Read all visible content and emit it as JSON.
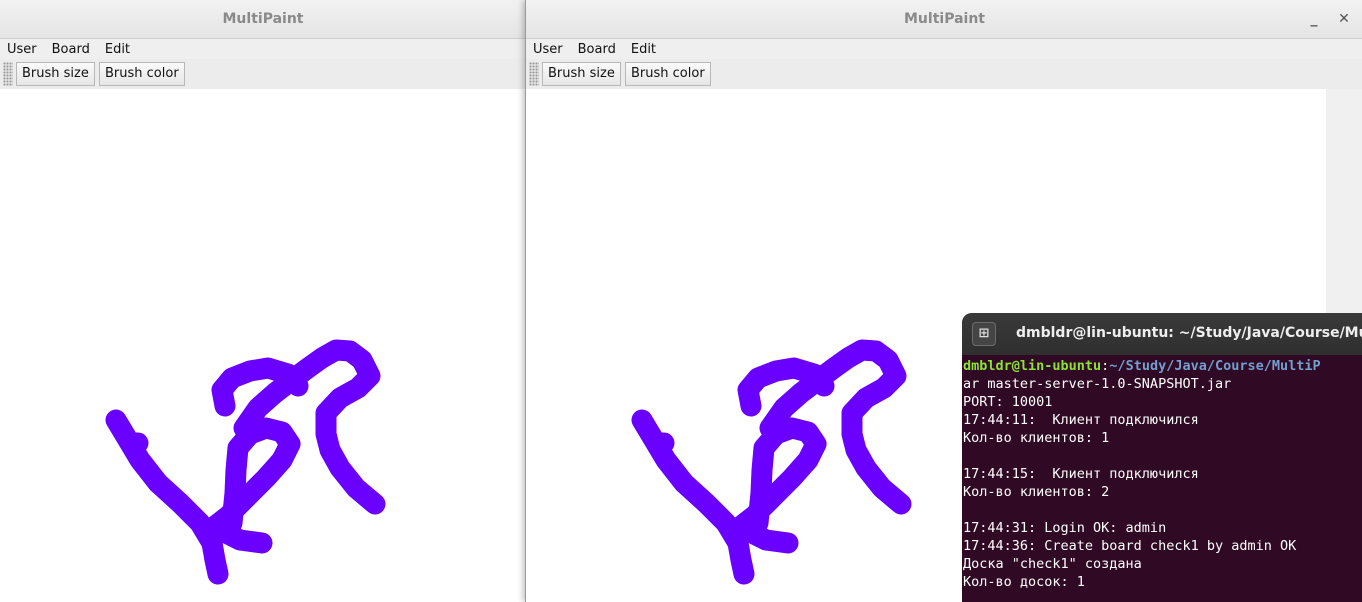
{
  "app": {
    "title": "MultiPaint",
    "menu": [
      "User",
      "Board",
      "Edit"
    ],
    "toolbar": {
      "brush_size": "Brush size",
      "brush_color": "Brush color"
    },
    "stroke_color": "#6a00ff",
    "window_controls": {
      "minimize": "_",
      "close": "✕"
    }
  },
  "terminal": {
    "title": "dmbldr@lin-ubuntu: ~/Study/Java/Course/MultiP",
    "prompt_user": "dmbldr@lin-ubuntu",
    "prompt_sep": ":",
    "prompt_path": "~/Study/Java/Course/MultiP",
    "lines": [
      "ar master-server-1.0-SNAPSHOT.jar",
      "PORT: 10001",
      "17:44:11:  Клиент подключился",
      "Кол-во клиентов: 1",
      "",
      "17:44:15:  Клиент подключился",
      "Кол-во клиентов: 2",
      "",
      "17:44:31: Login OK: admin",
      "17:44:36: Create board check1 by admin OK",
      "Доска \"check1\" создана",
      "Кол-во досок: 1"
    ],
    "background": "#300a24"
  }
}
